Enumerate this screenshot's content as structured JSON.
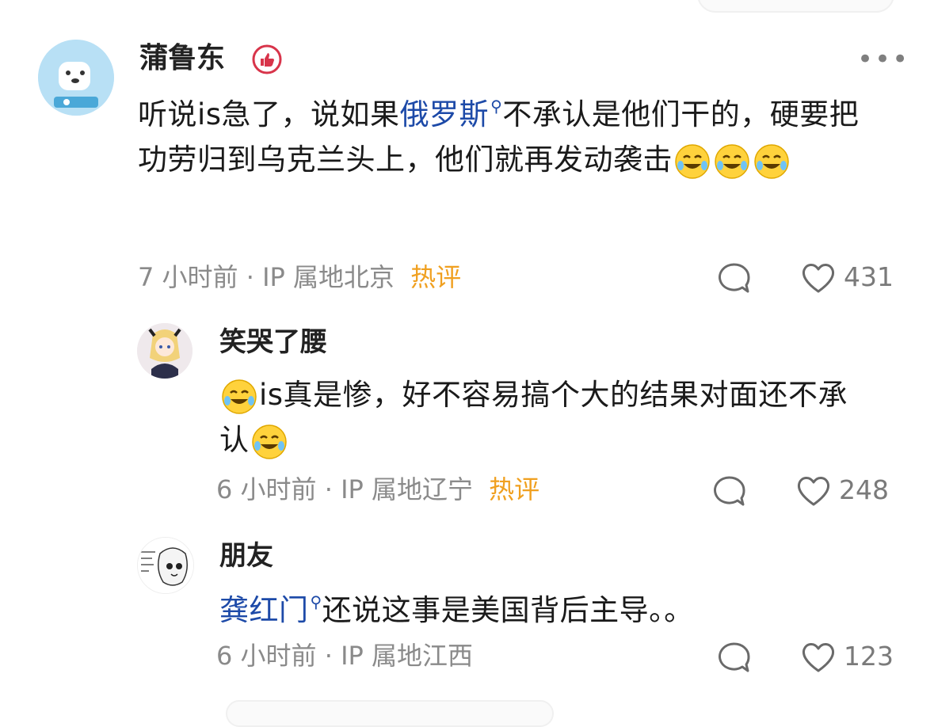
{
  "comments": [
    {
      "username": "蒲鲁东",
      "text_before": "听说is急了，说如果",
      "link_text": "俄罗斯",
      "text_after": "不承认是他们干的，硬要把功劳归到乌克兰头上，他们就再发动袭击",
      "time": "7 小时前",
      "location": "IP 属地北京",
      "hot_label": "热评",
      "likes": "431"
    },
    {
      "username": "笑哭了腰",
      "text_main": "is真是惨，好不容易搞个大的结果对面还不承认",
      "time": "6 小时前",
      "location": "IP 属地辽宁",
      "hot_label": "热评",
      "likes": "248"
    },
    {
      "username": "朋友",
      "link_text": "龚红门",
      "text_after": "还说这事是美国背后主导。。",
      "time": "6 小时前",
      "location": "IP 属地江西",
      "likes": "123"
    }
  ],
  "meta_separator": "·",
  "more_icon": "more-dots-icon",
  "colors": {
    "link": "#1d4aa8",
    "hot": "#f0a020",
    "meta": "#8a8a8a",
    "badge": "#d8344a"
  }
}
